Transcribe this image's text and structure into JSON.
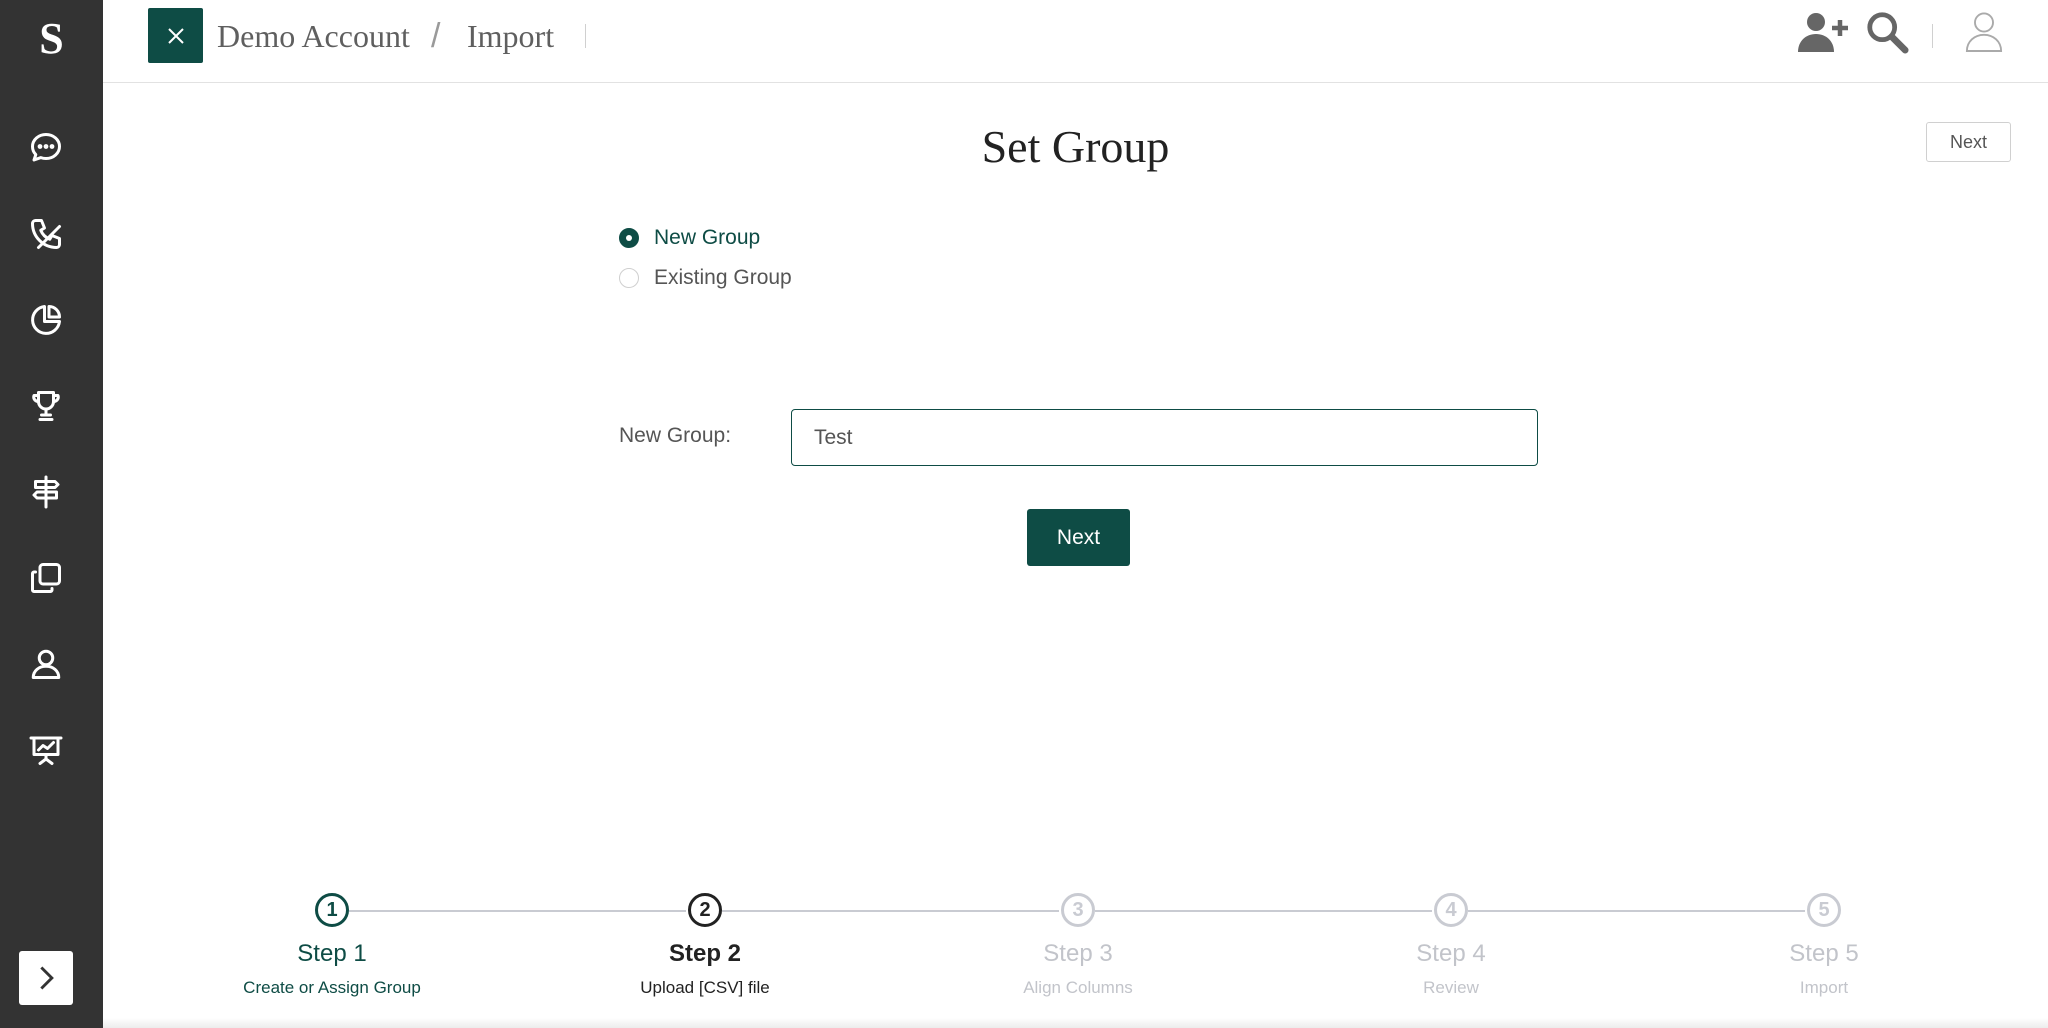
{
  "sidebar": {
    "logo": "S",
    "items": [
      {
        "name": "messages",
        "icon": "chat-bubble-icon"
      },
      {
        "name": "calls",
        "icon": "phone-icon"
      },
      {
        "name": "reports",
        "icon": "pie-chart-icon"
      },
      {
        "name": "goals",
        "icon": "trophy-icon"
      },
      {
        "name": "directions",
        "icon": "signpost-icon"
      },
      {
        "name": "templates",
        "icon": "copy-icon"
      },
      {
        "name": "contacts",
        "icon": "person-icon"
      },
      {
        "name": "presentation",
        "icon": "presentation-chart-icon"
      }
    ],
    "expand_icon": "chevron-right-icon"
  },
  "header": {
    "account": "Demo Account",
    "separator": "/",
    "page": "Import"
  },
  "main": {
    "title": "Set Group",
    "top_next_label": "Next",
    "radio_new_label": "New Group",
    "radio_existing_label": "Existing Group",
    "field_label": "New Group:",
    "field_value": "Test",
    "next_label": "Next"
  },
  "steps": [
    {
      "number": "1",
      "title": "Step 1",
      "subtitle": "Create or Assign Group",
      "state": "done"
    },
    {
      "number": "2",
      "title": "Step 2",
      "subtitle": "Upload [CSV] file",
      "state": "current"
    },
    {
      "number": "3",
      "title": "Step 3",
      "subtitle": "Align Columns",
      "state": "upcoming"
    },
    {
      "number": "4",
      "title": "Step 4",
      "subtitle": "Review",
      "state": "upcoming"
    },
    {
      "number": "5",
      "title": "Step 5",
      "subtitle": "Import",
      "state": "upcoming"
    }
  ],
  "colors": {
    "brand": "#0e4c45",
    "sidebar": "#333333",
    "inactive": "#c9cbd2"
  }
}
